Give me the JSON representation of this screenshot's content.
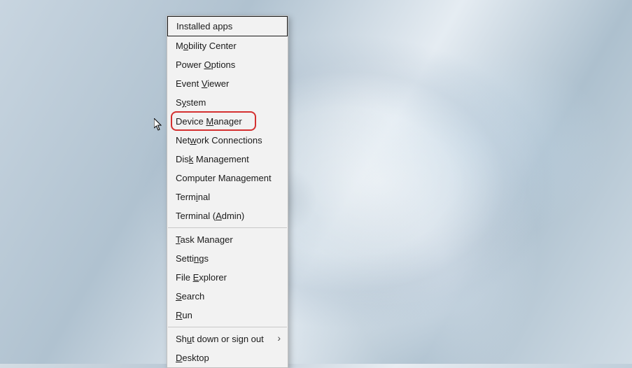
{
  "menu": {
    "items": [
      {
        "label": "Installed apps",
        "underline_char": null,
        "first": true
      },
      {
        "label": "Mobility Center",
        "underline_pos": 1,
        "pre": "M",
        "u": "o",
        "post": "bility Center"
      },
      {
        "label": "Power Options",
        "pre": "Power ",
        "u": "O",
        "post": "ptions"
      },
      {
        "label": "Event Viewer",
        "pre": "Event ",
        "u": "V",
        "post": "iewer"
      },
      {
        "label": "System",
        "pre": "S",
        "u": "y",
        "post": "stem"
      },
      {
        "label": "Device Manager",
        "pre": "Device ",
        "u": "M",
        "post": "anager",
        "highlighted": true
      },
      {
        "label": "Network Connections",
        "pre": "Net",
        "u": "w",
        "post": "ork Connections"
      },
      {
        "label": "Disk Management",
        "pre": "Dis",
        "u": "k",
        "post": " Management"
      },
      {
        "label": "Computer Management",
        "plain": "Computer Management"
      },
      {
        "label": "Terminal",
        "pre": "Term",
        "u": "i",
        "post": "nal"
      },
      {
        "label": "Terminal (Admin)",
        "pre": "Terminal (",
        "u": "A",
        "post": "dmin)"
      },
      {
        "separator": true
      },
      {
        "label": "Task Manager",
        "pre": "",
        "u": "T",
        "post": "ask Manager"
      },
      {
        "label": "Settings",
        "pre": "Setti",
        "u": "n",
        "post": "gs"
      },
      {
        "label": "File Explorer",
        "pre": "File ",
        "u": "E",
        "post": "xplorer"
      },
      {
        "label": "Search",
        "pre": "",
        "u": "S",
        "post": "earch"
      },
      {
        "label": "Run",
        "pre": "",
        "u": "R",
        "post": "un"
      },
      {
        "separator": true
      },
      {
        "label": "Shut down or sign out",
        "pre": "Sh",
        "u": "u",
        "post": "t down or sign out",
        "submenu": true
      },
      {
        "label": "Desktop",
        "pre": "",
        "u": "D",
        "post": "esktop"
      }
    ]
  },
  "highlight_color": "#d43030"
}
